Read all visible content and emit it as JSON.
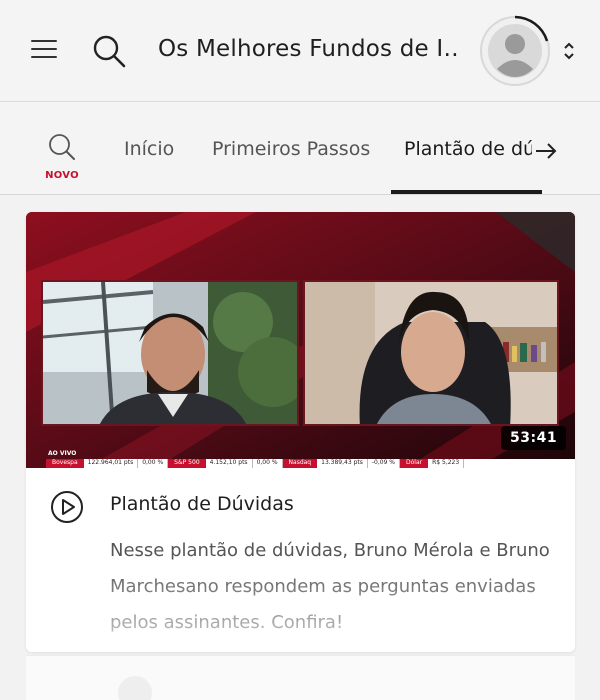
{
  "header": {
    "title": "Os Melhores Fundos de I…",
    "menu_icon": "hamburger-menu-icon",
    "search_icon": "search-icon",
    "avatar_icon": "user-avatar-icon",
    "switch_icon": "chevron-up-down-icon"
  },
  "tabs": {
    "search_badge": "NOVO",
    "items": [
      {
        "label": "Início",
        "active": false
      },
      {
        "label": "Primeiros Passos",
        "active": false
      },
      {
        "label": "Plantão de dúvidas",
        "active": true
      }
    ],
    "next_icon": "arrow-right-icon"
  },
  "card": {
    "duration": "53:41",
    "live_label": "AO VIVO",
    "ticker": [
      {
        "label": "Bovespa",
        "value": "122.964,01 pts",
        "change": "0,00 %"
      },
      {
        "label": "S&P 500",
        "value": "4.152,10 pts",
        "change": "0,00 %"
      },
      {
        "label": "Nasdaq",
        "value": "13.389,43 pts",
        "change": "-0,09 %"
      },
      {
        "label": "Dólar",
        "value": "R$ 5,223",
        "change": ""
      }
    ],
    "play_icon": "play-circle-icon",
    "title": "Plantão de Dúvidas",
    "description": "Nesse plantão de dúvidas, Bruno Mérola e Bruno Marchesano respondem as perguntas enviadas pelos assinantes. Confira!"
  },
  "colors": {
    "accent": "#c8102e",
    "background": "#f2f2f2",
    "video_bg": "#3a0a12"
  }
}
